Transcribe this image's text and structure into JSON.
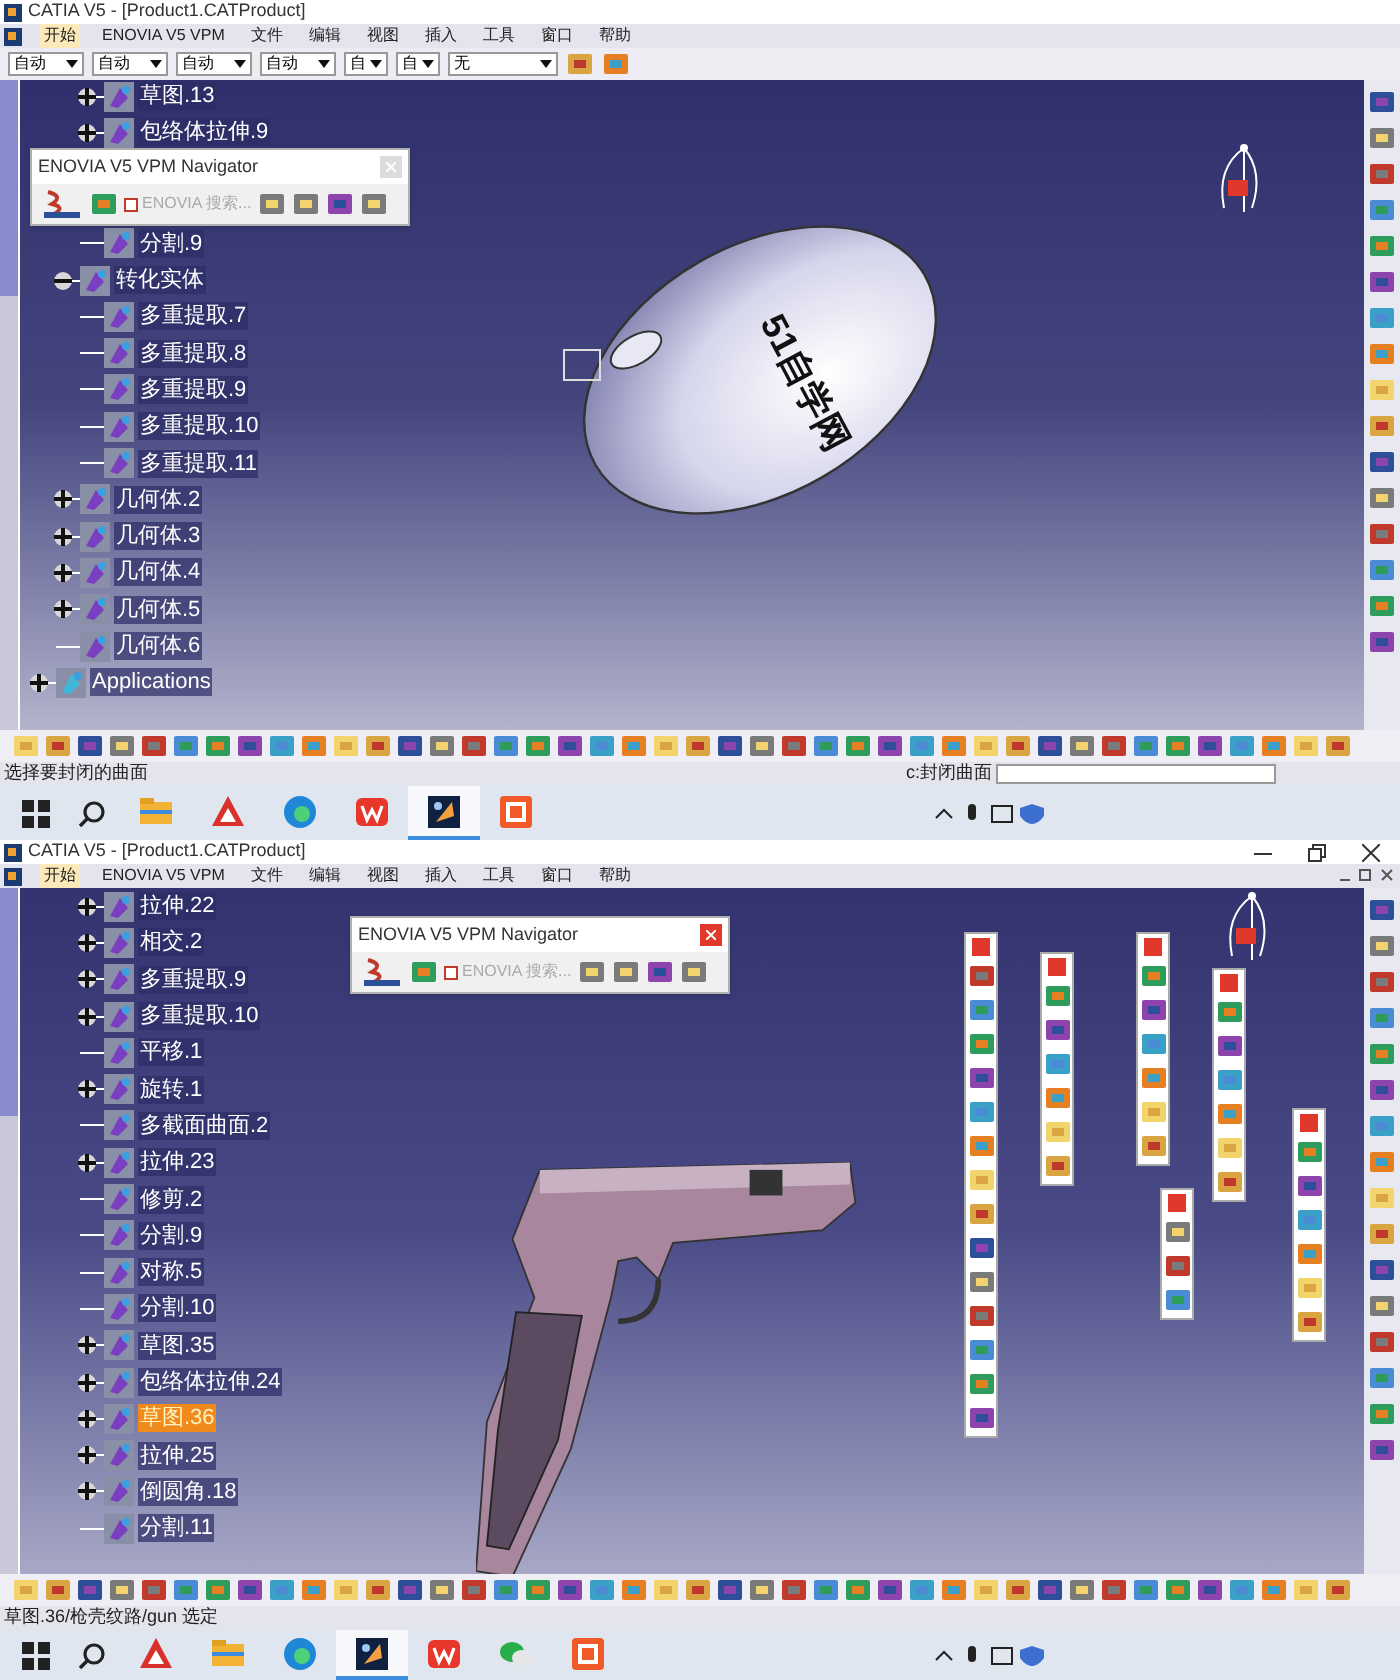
{
  "windows": [
    {
      "title": "CATIA V5 - [Product1.CATProduct]",
      "window_controls": false,
      "menu": [
        {
          "label": "开始",
          "selected": true
        },
        {
          "label": "ENOVIA V5 VPM",
          "selected": false
        },
        {
          "label": "文件",
          "selected": false
        },
        {
          "label": "编辑",
          "selected": false
        },
        {
          "label": "视图",
          "selected": false
        },
        {
          "label": "插入",
          "selected": false
        },
        {
          "label": "工具",
          "selected": false
        },
        {
          "label": "窗口",
          "selected": false
        },
        {
          "label": "帮助",
          "selected": false
        }
      ],
      "combos": [
        {
          "value": "自动"
        },
        {
          "value": "自动"
        },
        {
          "value": "自动"
        },
        {
          "value": "自动"
        },
        {
          "value": "自"
        },
        {
          "value": "自"
        },
        {
          "value": "无"
        }
      ],
      "navigator": {
        "title": "ENOVIA V5 VPM Navigator",
        "search_label": "ENOVIA 搜索...",
        "search_checked": false,
        "close_active": false
      },
      "model": {
        "kind": "mouse",
        "label": "51自学网"
      },
      "tree": [
        {
          "children": [
            {
              "children": [
                {
                  "label": "草图.13",
                  "expanded": false,
                  "selected": false
                },
                {
                  "label": "包络体拉伸.9",
                  "expanded": false,
                  "selected": false
                },
                {
                  "label": "分割.9",
                  "selected": false
                }
              ]
            },
            {
              "label": "转化实体",
              "expanded": true,
              "selected": false,
              "children": [
                {
                  "label": "多重提取.7",
                  "selected": false
                },
                {
                  "label": "多重提取.8",
                  "selected": false
                },
                {
                  "label": "多重提取.9",
                  "selected": false
                },
                {
                  "label": "多重提取.10",
                  "selected": false
                },
                {
                  "label": "多重提取.11",
                  "selected": false
                }
              ]
            },
            {
              "label": "几何体.2",
              "expanded": false,
              "selected": false
            },
            {
              "label": "几何体.3",
              "expanded": false,
              "selected": false
            },
            {
              "label": "几何体.4",
              "expanded": false,
              "selected": false
            },
            {
              "label": "几何体.5",
              "expanded": false,
              "selected": false
            },
            {
              "label": "几何体.6",
              "selected": false
            }
          ]
        },
        {
          "label": "Applications",
          "expanded": false,
          "selected": false
        }
      ],
      "status_prompt": "选择要封闭的曲面",
      "status_command": "c:封闭曲面",
      "taskbar_apps": [
        {
          "kind": "folder",
          "selected": false
        },
        {
          "kind": "pdf",
          "selected": false
        },
        {
          "kind": "browser",
          "selected": false
        },
        {
          "kind": "office",
          "selected": false
        },
        {
          "kind": "catia",
          "selected": true
        },
        {
          "kind": "orange",
          "selected": false
        }
      ]
    },
    {
      "title": "CATIA V5 - [Product1.CATProduct]",
      "window_controls": true,
      "menu": [
        {
          "label": "开始",
          "selected": true
        },
        {
          "label": "ENOVIA V5 VPM",
          "selected": false
        },
        {
          "label": "文件",
          "selected": false
        },
        {
          "label": "编辑",
          "selected": false
        },
        {
          "label": "视图",
          "selected": false
        },
        {
          "label": "插入",
          "selected": false
        },
        {
          "label": "工具",
          "selected": false
        },
        {
          "label": "窗口",
          "selected": false
        },
        {
          "label": "帮助",
          "selected": false
        }
      ],
      "navigator": {
        "title": "ENOVIA V5 VPM Navigator",
        "search_label": "ENOVIA 搜索...",
        "search_checked": false,
        "close_active": true
      },
      "model": {
        "kind": "gun"
      },
      "tree": [
        {
          "children": [
            {
              "children": [
                {
                  "label": "拉伸.22",
                  "expanded": false,
                  "selected": false
                },
                {
                  "label": "相交.2",
                  "expanded": false,
                  "selected": false
                },
                {
                  "label": "多重提取.9",
                  "expanded": false,
                  "selected": false
                },
                {
                  "label": "多重提取.10",
                  "expanded": false,
                  "selected": false
                },
                {
                  "label": "平移.1",
                  "selected": false
                },
                {
                  "label": "旋转.1",
                  "expanded": false,
                  "selected": false
                },
                {
                  "label": "多截面曲面.2",
                  "selected": false
                },
                {
                  "label": "拉伸.23",
                  "expanded": false,
                  "selected": false
                },
                {
                  "label": "修剪.2",
                  "selected": false
                },
                {
                  "label": "分割.9",
                  "selected": false
                },
                {
                  "label": "对称.5",
                  "selected": false
                },
                {
                  "label": "分割.10",
                  "selected": false
                },
                {
                  "label": "草图.35",
                  "expanded": false,
                  "selected": false
                },
                {
                  "label": "包络体拉伸.24",
                  "expanded": false,
                  "selected": false
                },
                {
                  "label": "草图.36",
                  "expanded": false,
                  "selected": true
                },
                {
                  "label": "拉伸.25",
                  "expanded": false,
                  "selected": false
                },
                {
                  "label": "倒圆角.18",
                  "expanded": false,
                  "selected": false
                },
                {
                  "label": "分割.11",
                  "selected": false
                }
              ]
            }
          ]
        }
      ],
      "status_prompt": "草图.36/枪壳纹路/gun 选定",
      "taskbar_apps": [
        {
          "kind": "pdf",
          "selected": false
        },
        {
          "kind": "folder",
          "selected": false
        },
        {
          "kind": "browser",
          "selected": false
        },
        {
          "kind": "catia",
          "selected": true
        },
        {
          "kind": "office",
          "selected": false
        },
        {
          "kind": "chat",
          "selected": false
        },
        {
          "kind": "orange",
          "selected": false
        }
      ]
    }
  ]
}
